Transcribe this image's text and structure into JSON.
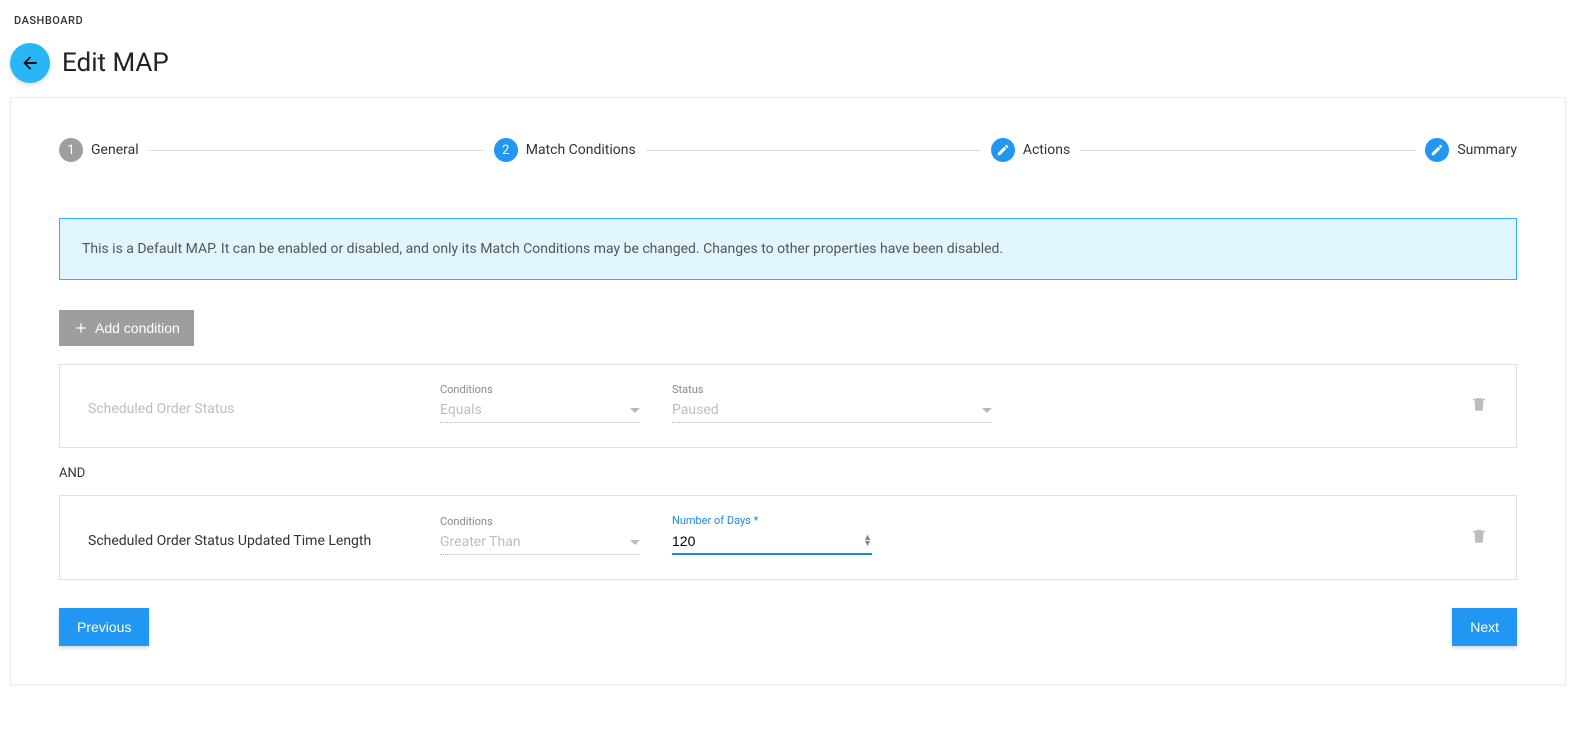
{
  "breadcrumb": "DASHBOARD",
  "page_title": "Edit MAP",
  "stepper": {
    "steps": [
      {
        "label": "General",
        "state": "done-gray",
        "num": "1"
      },
      {
        "label": "Match Conditions",
        "state": "active",
        "num": "2"
      },
      {
        "label": "Actions",
        "state": "edit"
      },
      {
        "label": "Summary",
        "state": "edit"
      }
    ]
  },
  "info_banner": "This is a Default MAP. It can be enabled or disabled, and only its Match Conditions may be changed. Changes to other properties have been disabled.",
  "add_condition_label": "Add condition",
  "conditions": {
    "row1": {
      "name": "Scheduled Order Status",
      "conditions_label": "Conditions",
      "conditions_value": "Equals",
      "status_label": "Status",
      "status_value": "Paused"
    },
    "join": "AND",
    "row2": {
      "name": "Scheduled Order Status Updated Time Length",
      "conditions_label": "Conditions",
      "conditions_value": "Greater Than",
      "days_label": "Number of Days *",
      "days_value": "120"
    }
  },
  "buttons": {
    "previous": "Previous",
    "next": "Next"
  }
}
